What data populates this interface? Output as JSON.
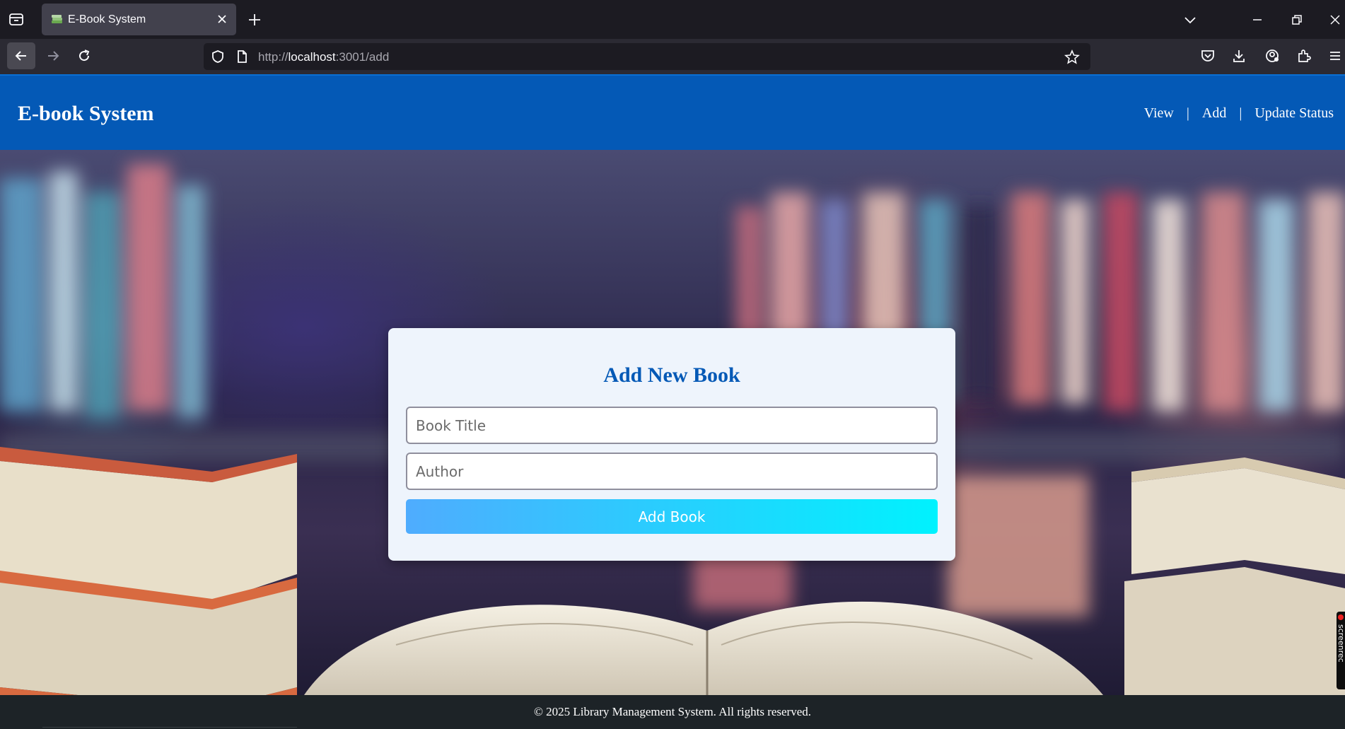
{
  "browser": {
    "tab_title": "E-Book System",
    "url_prefix": "http://",
    "url_host": "localhost",
    "url_path": ":3001/add"
  },
  "site": {
    "brand": "E-book System",
    "nav": {
      "view": "View",
      "sep1": "|",
      "add": "Add",
      "sep2": "|",
      "update": "Update Status"
    },
    "colors": {
      "header_bg": "#0459b6",
      "button_gradient_start": "#4facfe",
      "button_gradient_end": "#00f2fe",
      "footer_bg": "#1d2327"
    }
  },
  "form": {
    "heading": "Add New Book",
    "title_placeholder": "Book Title",
    "author_placeholder": "Author",
    "submit_label": "Add Book"
  },
  "footer": {
    "text": "© 2025 Library Management System. All rights reserved."
  },
  "overlay": {
    "recorder_text": "screenrec"
  }
}
